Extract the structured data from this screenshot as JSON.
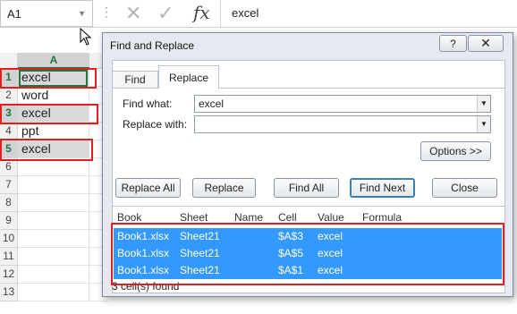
{
  "excel": {
    "name_box": "A1",
    "formula": "excel",
    "fx_label": "fx",
    "column_a": "A",
    "rows": [
      {
        "num": "1",
        "value": "excel",
        "selected": true
      },
      {
        "num": "2",
        "value": "word",
        "selected": false
      },
      {
        "num": "3",
        "value": "excel",
        "selected": true
      },
      {
        "num": "4",
        "value": "ppt",
        "selected": false
      },
      {
        "num": "5",
        "value": "excel",
        "selected": true
      },
      {
        "num": "6",
        "value": "",
        "selected": false
      },
      {
        "num": "7",
        "value": "",
        "selected": false
      },
      {
        "num": "8",
        "value": "",
        "selected": false
      },
      {
        "num": "9",
        "value": "",
        "selected": false
      },
      {
        "num": "10",
        "value": "",
        "selected": false
      },
      {
        "num": "11",
        "value": "",
        "selected": false
      },
      {
        "num": "12",
        "value": "",
        "selected": false
      },
      {
        "num": "13",
        "value": "",
        "selected": false
      }
    ]
  },
  "dialog": {
    "title": "Find and Replace",
    "help": "?",
    "close": "✕",
    "tabs": [
      "Find",
      "Replace"
    ],
    "find_label": "Find what:",
    "find_value": "excel",
    "replace_label": "Replace with:",
    "replace_value": "",
    "options_button": "Options >>",
    "buttons": {
      "replace_all": "Replace All",
      "replace": "Replace",
      "find_all": "Find All",
      "find_next": "Find Next",
      "close": "Close"
    },
    "result_headers": [
      "Book",
      "Sheet",
      "Name",
      "Cell",
      "Value",
      "Formula"
    ],
    "results": [
      {
        "book": "Book1.xlsx",
        "sheet": "Sheet21",
        "name": "",
        "cell": "$A$3",
        "value": "excel",
        "formula": ""
      },
      {
        "book": "Book1.xlsx",
        "sheet": "Sheet21",
        "name": "",
        "cell": "$A$5",
        "value": "excel",
        "formula": ""
      },
      {
        "book": "Book1.xlsx",
        "sheet": "Sheet21",
        "name": "",
        "cell": "$A$1",
        "value": "excel",
        "formula": ""
      }
    ],
    "status": "3 cell(s) found"
  },
  "colors": {
    "highlight": "#e02020",
    "selection": "#3399ff",
    "excel_green": "#217346"
  }
}
